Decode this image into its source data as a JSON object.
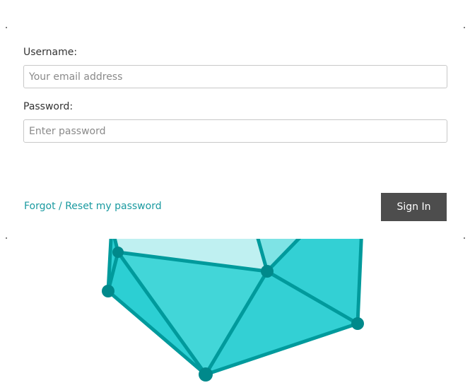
{
  "form": {
    "username_label": "Username:",
    "username_placeholder": "Your email address",
    "username_value": "",
    "password_label": "Password:",
    "password_placeholder": "Enter password",
    "password_value": ""
  },
  "actions": {
    "forgot_label": "Forgot / Reset my password",
    "signin_label": "Sign In"
  },
  "colors": {
    "link": "#1a9aa0",
    "button_bg": "#4d4d4d",
    "logo_stroke": "#009a9c",
    "logo_fill_dark": "#2ccfd3",
    "logo_fill_mid": "#42d6d8",
    "logo_fill_light": "#bff0f1"
  },
  "icons": {
    "logo": "crystal-polyhedron-logo"
  }
}
